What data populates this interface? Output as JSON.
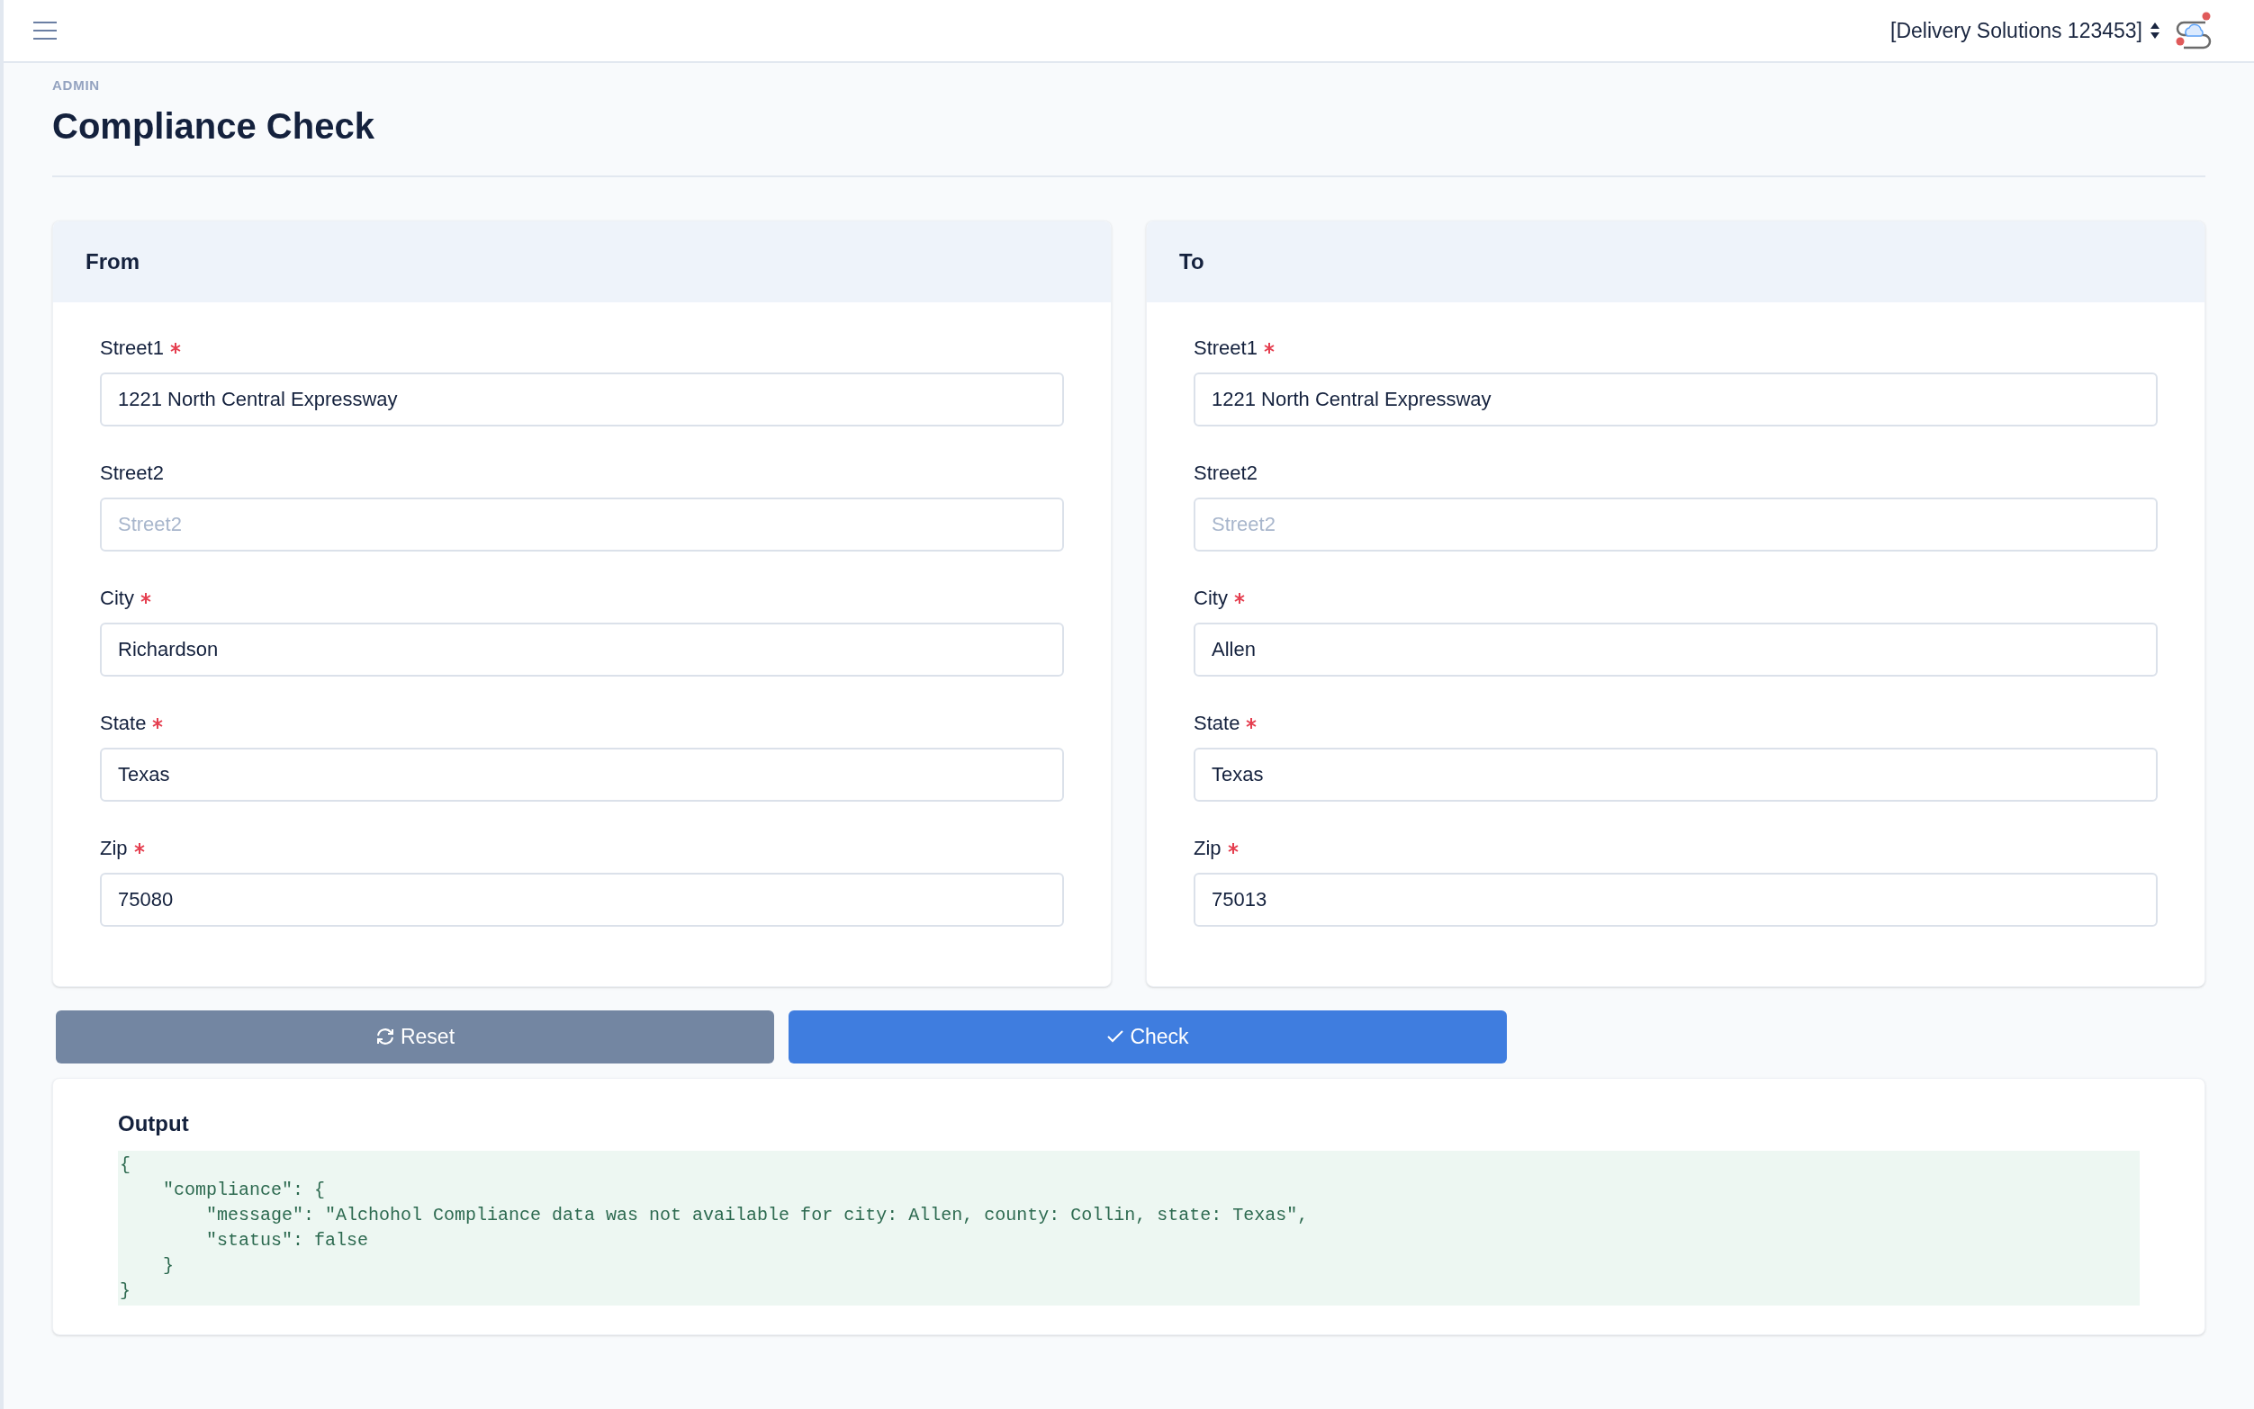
{
  "top_bar": {
    "account": "[Delivery Solutions 123453]"
  },
  "breadcrumb": "ADMIN",
  "title": "Compliance Check",
  "panels": [
    {
      "title": "From",
      "fields": [
        {
          "label": "Street1",
          "required": true,
          "value": "1221 North Central Expressway"
        },
        {
          "label": "Street2",
          "required": false,
          "placeholder": "Street2"
        },
        {
          "label": "City",
          "required": true,
          "value": "Richardson"
        },
        {
          "label": "State",
          "required": true,
          "value": "Texas"
        },
        {
          "label": "Zip",
          "required": true,
          "value": "75080"
        }
      ]
    },
    {
      "title": "To",
      "fields": [
        {
          "label": "Street1",
          "required": true,
          "value": "1221 North Central Expressway"
        },
        {
          "label": "Street2",
          "required": false,
          "placeholder": "Street2"
        },
        {
          "label": "City",
          "required": true,
          "value": "Allen"
        },
        {
          "label": "State",
          "required": true,
          "value": "Texas"
        },
        {
          "label": "Zip",
          "required": true,
          "value": "75013"
        }
      ]
    }
  ],
  "buttons": [
    {
      "kind": "reset",
      "label": "Reset"
    },
    {
      "kind": "check",
      "label": "Check"
    }
  ],
  "output": {
    "title": "Output",
    "lines": [
      "{",
      "    \"compliance\": {",
      "        \"message\": \"Alchohol Compliance data was not available for city: Allen, county: Collin, state: Texas\",",
      "        \"status\": false",
      "    }",
      "}"
    ]
  }
}
